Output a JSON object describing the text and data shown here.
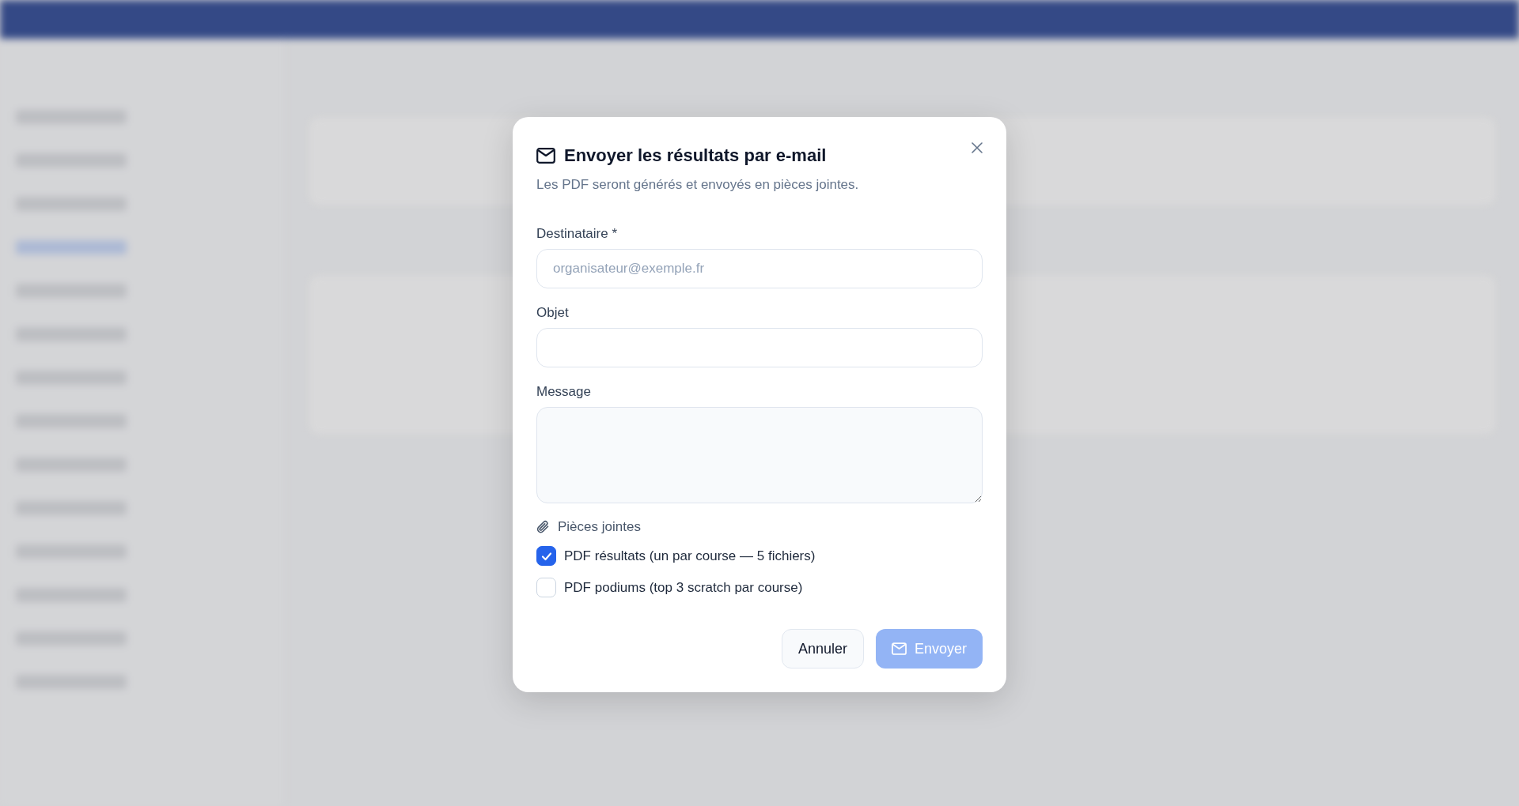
{
  "dialog": {
    "title": "Envoyer les résultats par e-mail",
    "subtitle": "Les PDF seront générés et envoyés en pièces jointes.",
    "fields": [
      {
        "kind": "input",
        "label": "Destinataire *",
        "placeholder": "organisateur@exemple.fr"
      },
      {
        "kind": "input",
        "label": "Objet"
      },
      {
        "kind": "textarea",
        "label": "Message"
      }
    ],
    "attachments": {
      "label": "Pièces jointes",
      "options": [
        {
          "label": "PDF résultats (un par course — 5 fichiers)",
          "checked": true
        },
        {
          "label": "PDF podiums (top 3 scratch par course)",
          "checked": false
        }
      ]
    },
    "buttons": [
      {
        "kind": "secondary",
        "label": "Annuler",
        "disabled": false
      },
      {
        "kind": "primary",
        "label": "Envoyer",
        "disabled": true
      }
    ]
  }
}
